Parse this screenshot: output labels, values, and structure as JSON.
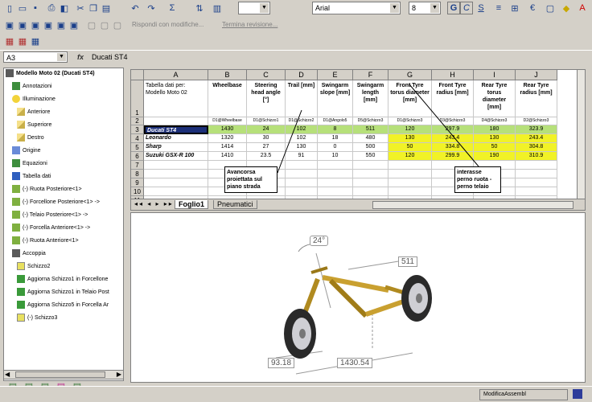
{
  "formula_bar": {
    "cell_ref": "A3",
    "fx": "fx",
    "value": "Ducati ST4"
  },
  "font_combo": {
    "font": "Arial",
    "size": "8"
  },
  "review_bar": {
    "reply_label": "Rispondi con modifiche...",
    "end_label": "Termina revisione..."
  },
  "tree": {
    "root": "Modello Moto 02  (Ducati ST4)",
    "items": [
      "Annotazioni",
      "Illuminazione",
      "Anteriore",
      "Superiore",
      "Destro",
      "Origine",
      "Equazioni",
      "Tabella dati",
      "(-) Ruota Posteriore<1>",
      "(-) Forcellone Posteriore<1> ->",
      "(-) Telaio Posteriore<1> ->",
      "(-) Forcella Anteriore<1> ->",
      "(-) Ruota Anteriore<1>",
      "Accoppia",
      "Schizzo2",
      "Aggiorna Schizzo1 in Forcellone",
      "Aggiorna Schizzo1 in Telaio Post",
      "Aggiorna Schizzo5 in Forcella Ar",
      "(-) Schizzo3"
    ]
  },
  "sheet": {
    "columns": [
      "A",
      "B",
      "C",
      "D",
      "E",
      "F",
      "G",
      "H",
      "I",
      "J"
    ],
    "row_numbers": [
      "1",
      "2",
      "3",
      "4",
      "5",
      "6",
      "7",
      "8",
      "9",
      "10",
      "11"
    ],
    "header_row": [
      "Tabella dati per: Modello Moto 02",
      "Wheelbase",
      "Steering head angle [°]",
      "Trail [mm]",
      "Swingarm slope [mm]",
      "Swingarm length [mm]",
      "Front Tyre torus diameter [mm]",
      "Front Tyre radius [mm]",
      "Rear Tyre torus diameter [mm]",
      "Rear Tyre radius [mm]"
    ],
    "ref_row": [
      "",
      "D1@Wheelbase",
      "D1@Schizzo1",
      "D1@Schizzo2",
      "D1@Angolo5",
      "D5@Schizzo3",
      "D1@Schizzo3",
      "D3@Schizzo3",
      "D4@Schizzo3",
      "D2@Schizzo3"
    ],
    "rows": [
      [
        "Ducati ST4",
        "1430",
        "24",
        "102",
        "8",
        "511",
        "120",
        "297.9",
        "180",
        "323.9"
      ],
      [
        "Leonardo",
        "1320",
        "30",
        "102",
        "18",
        "480",
        "130",
        "243.4",
        "130",
        "243.4"
      ],
      [
        "Sharp",
        "1414",
        "27",
        "130",
        "0",
        "500",
        "50",
        "334.8",
        "50",
        "304.8"
      ],
      [
        "Suzuki GSX-R 100",
        "1410",
        "23.5",
        "91",
        "10",
        "550",
        "120",
        "299.9",
        "190",
        "310.9"
      ]
    ],
    "note_avancorsa": "Avancorsa proiettata sul piano strada",
    "note_interasse": "interasse perno ruota - perno telaio",
    "tabs": [
      "Foglio1",
      "Pneumatici"
    ]
  },
  "graphics": {
    "dim_angle": "24°",
    "dim_swingarm": "511",
    "dim_trail": "93.18",
    "dim_wheelbase": "1430.54"
  },
  "status": {
    "mode": "ModificaAssembl"
  }
}
